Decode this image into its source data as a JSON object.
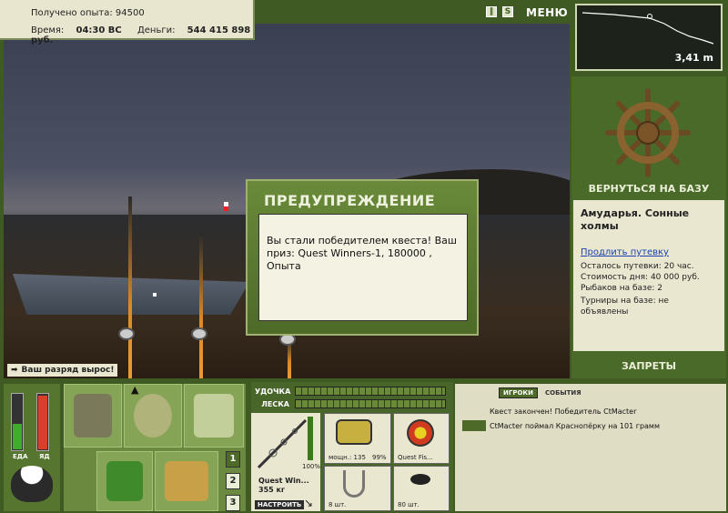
{
  "info": {
    "exp_label": "Получено опыта:",
    "exp_value": "94500",
    "time_label": "Время:",
    "time_value": "04:30 ВС",
    "money_label": "Деньги:",
    "money_value": "544 415 898 руб."
  },
  "top": {
    "pause_icon": "pause-icon",
    "save_icon": "s-icon",
    "menu_label": "МЕНЮ"
  },
  "depth": {
    "value": "3,41 m"
  },
  "right": {
    "return_label": "ВЕРНУТЬСЯ НА БАЗУ",
    "base_name": "Амударья. Сонные холмы",
    "extend_link": "Продлить путевку",
    "remaining": "Осталось путевки: 20 час.",
    "day_cost": "Стоимость дня: 40 000 руб.",
    "anglers": "Рыбаков на базе: 2",
    "tournaments": "Турниры на базе: не объявлены",
    "bans_label": "ЗАПРЕТЫ"
  },
  "modal": {
    "title": "ПРЕДУПРЕЖДЕНИЕ",
    "message": "Вы стали победителем квеста! Ваш приз: Quest Winners-1, 180000 , Опыта"
  },
  "rank": {
    "message": "Ваш разряд вырос!"
  },
  "meters": {
    "food_label": "ЕДА",
    "poison_label": "ЯД",
    "food_level": 0.45,
    "poison_level": 0.95
  },
  "inventory": {
    "pages": [
      "1",
      "2",
      "3"
    ],
    "active_page": "1"
  },
  "tackle": {
    "rod_label": "УДОЧКА",
    "line_label": "ЛЕСКА",
    "rod_name": "Quest Win...",
    "rod_weight": "355 кг",
    "rod_condition": "100%",
    "setup_button": "НАСТРОИТЬ",
    "reel_power": "мощн.: 135",
    "reel_condition": "99%",
    "line_name": "Quest Fis...",
    "hook_count": "8 шт.",
    "bait_count": "80 шт."
  },
  "log": {
    "tab_players": "ИГРОКИ",
    "tab_events": "СОБЫТИЯ",
    "entry1": "Квест закончен! Победитель CtMacter",
    "entry2": "CtMacter поймал Краснопёрку на 101 грамм"
  },
  "colors": {
    "panel_green": "#4a6a2a",
    "panel_cream": "#eae7d0",
    "poison_red": "#d8402a",
    "food_green": "#3fae2a"
  }
}
